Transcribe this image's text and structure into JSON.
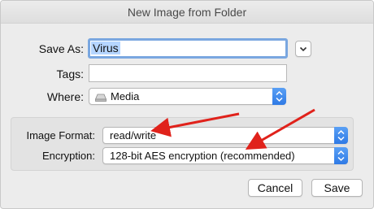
{
  "dialog": {
    "title": "New Image from Folder",
    "save_as": {
      "label": "Save As:",
      "value": "Virus"
    },
    "tags": {
      "label": "Tags:",
      "value": ""
    },
    "where": {
      "label": "Where:",
      "value": "Media"
    },
    "options": {
      "image_format": {
        "label": "Image Format:",
        "value": "read/write"
      },
      "encryption": {
        "label": "Encryption:",
        "value": "128-bit AES encryption (recommended)"
      }
    },
    "buttons": {
      "cancel": "Cancel",
      "save": "Save"
    }
  },
  "colors": {
    "accent": "#2f7ae5",
    "focus_ring": "#7aa7e0",
    "selection": "#b5d5ff",
    "annotation_arrow": "#e0221b"
  }
}
